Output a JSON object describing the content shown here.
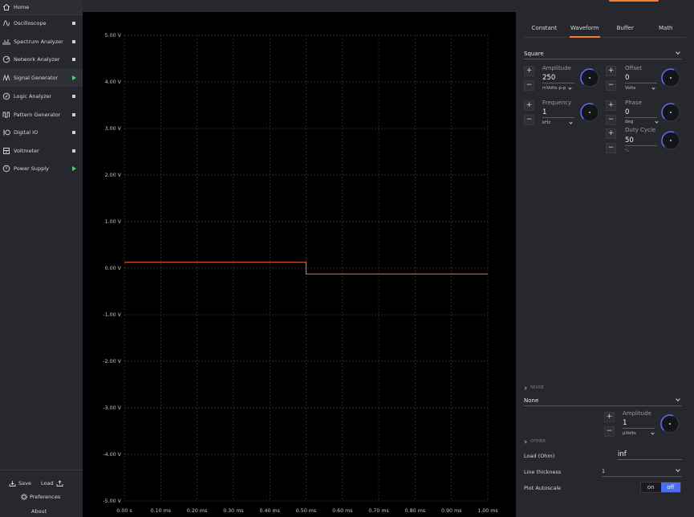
{
  "nav": {
    "home": "Home",
    "items": [
      {
        "label": "Oscilloscope",
        "state": "stopped",
        "icon": "oscilloscope-icon"
      },
      {
        "label": "Spectrum Analyzer",
        "state": "stopped",
        "icon": "spectrum-analyzer-icon"
      },
      {
        "label": "Network Analyzer",
        "state": "stopped",
        "icon": "network-analyzer-icon"
      },
      {
        "label": "Signal Generator",
        "state": "running",
        "icon": "signal-generator-icon"
      },
      {
        "label": "Logic Analyzer",
        "state": "stopped",
        "icon": "logic-analyzer-icon"
      },
      {
        "label": "Pattern Generator",
        "state": "stopped",
        "icon": "pattern-generator-icon"
      },
      {
        "label": "Digital IO",
        "state": "stopped",
        "icon": "digital-io-icon"
      },
      {
        "label": "Voltmeter",
        "state": "stopped",
        "icon": "voltmeter-icon"
      },
      {
        "label": "Power Supply",
        "state": "running",
        "icon": "power-supply-icon"
      }
    ],
    "save": "Save",
    "load": "Load",
    "preferences": "Preferences",
    "about": "About"
  },
  "tabs": [
    "Constant",
    "Waveform",
    "Buffer",
    "Math"
  ],
  "active_tab": "Waveform",
  "waveform": {
    "type": "Square",
    "amplitude": {
      "label": "Amplitude",
      "value": "250",
      "unit": "mVolts p-p"
    },
    "offset": {
      "label": "Offset",
      "value": "0",
      "unit": "Volts"
    },
    "frequency": {
      "label": "Frequency",
      "value": "1",
      "unit": "kHz"
    },
    "phase": {
      "label": "Phase",
      "value": "0",
      "unit": "deg"
    },
    "duty_cycle": {
      "label": "Duty Cycle",
      "value": "50",
      "unit": "%"
    }
  },
  "noise": {
    "header": "NOISE",
    "type": "None",
    "amplitude": {
      "label": "Amplitude",
      "value": "1",
      "unit": "μVolts"
    }
  },
  "other": {
    "header": "OTHER",
    "load_label": "Load (Ohm)",
    "load_value": "inf",
    "line_thickness_label": "Line thickness",
    "line_thickness_value": "1",
    "plot_autoscale_label": "Plot Autoscale",
    "toggle_on": "on",
    "toggle_off": "off",
    "plot_autoscale": "off"
  },
  "colors": {
    "accent": "#ff7a2e",
    "trace": "#ff6a2a",
    "running": "#4fcf7a",
    "toggle_active": "#4a6cf7",
    "knob_arc": "#5a6cf0"
  },
  "chart_data": {
    "type": "line",
    "y_tick_labels": [
      "5.00 V",
      "4.00 V",
      "3.00 V",
      "2.00 V",
      "1.00 V",
      "0.00 V",
      "-1.00 V",
      "-2.00 V",
      "-3.00 V",
      "-4.00 V",
      "-5.00 V"
    ],
    "x_tick_labels": [
      "0.00 s",
      "0.10 ms",
      "0.20 ms",
      "0.30 ms",
      "0.40 ms",
      "0.50 ms",
      "0.60 ms",
      "0.70 ms",
      "0.80 ms",
      "0.90 ms",
      "1.00 ms"
    ],
    "xlim": [
      0,
      1.0
    ],
    "ylim": [
      -5,
      5
    ],
    "grid": true,
    "series": [
      {
        "x": [
          0,
          0.5,
          0.5,
          1.0
        ],
        "y": [
          0.125,
          0.125,
          -0.125,
          -0.125
        ]
      }
    ]
  }
}
